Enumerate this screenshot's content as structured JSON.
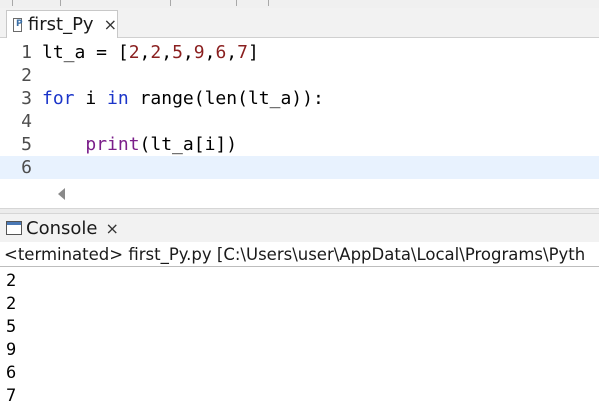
{
  "editor": {
    "tab_title": "first_Py",
    "tab_close": "×",
    "lines": [
      {
        "number": "1"
      },
      {
        "number": "2"
      },
      {
        "number": "3"
      },
      {
        "number": "4"
      },
      {
        "number": "5"
      },
      {
        "number": "6"
      }
    ],
    "tokens": {
      "l1_var": "lt_a = [",
      "l1_n1": "2",
      "l1_c1": ",",
      "l1_n2": "2",
      "l1_c2": ",",
      "l1_n3": "5",
      "l1_c3": ",",
      "l1_n4": "9",
      "l1_c4": ",",
      "l1_n5": "6",
      "l1_c5": ",",
      "l1_n6": "7",
      "l1_end": "]",
      "l3_for": "for",
      "l3_i": " i ",
      "l3_in": "in",
      "l3_sp": " ",
      "l3_range": "range",
      "l3_p1": "(",
      "l3_len": "len",
      "l3_rest": "(lt_a)):",
      "l5_indent": "    ",
      "l5_print": "print",
      "l5_rest": "(lt_a[i])"
    }
  },
  "console": {
    "tab_title": "Console",
    "tab_close": "×",
    "status": "<terminated> first_Py.py [C:\\Users\\user\\AppData\\Local\\Programs\\Pyth",
    "output": [
      "2",
      "2",
      "5",
      "9",
      "6",
      "7"
    ]
  },
  "colors": {
    "keyword": "#1b35c9",
    "builtin": "#7b1e8a",
    "number": "#8a1f1f",
    "current_line": "#e8f2fe"
  }
}
